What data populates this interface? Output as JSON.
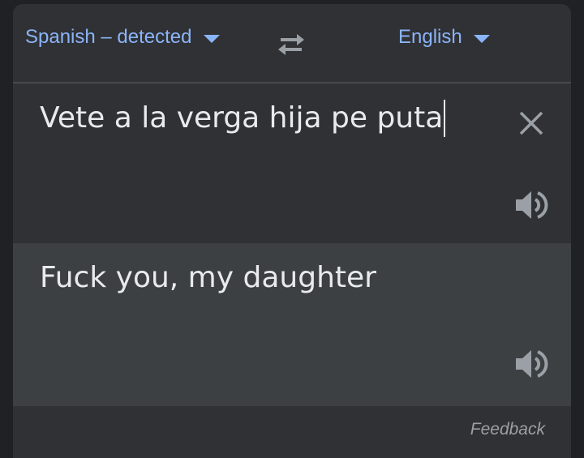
{
  "header": {
    "source_language": "Spanish – detected",
    "target_language": "English",
    "swap_icon": "swap-arrows-icon",
    "dropdown_icon": "caret-down-icon"
  },
  "source": {
    "text": "Vete a la verga hija pe puta",
    "clear_icon": "close-icon",
    "speak_icon": "speaker-icon"
  },
  "result": {
    "text": "Fuck you, my daughter",
    "speak_icon": "speaker-icon"
  },
  "footer": {
    "feedback_label": "Feedback"
  },
  "colors": {
    "accent": "#8ab4f8",
    "text": "#e8eaed",
    "muted": "#9aa0a6",
    "icon": "#9aa0a6",
    "panel": "#303134",
    "result_panel": "#3c4043",
    "page": "#202124"
  }
}
